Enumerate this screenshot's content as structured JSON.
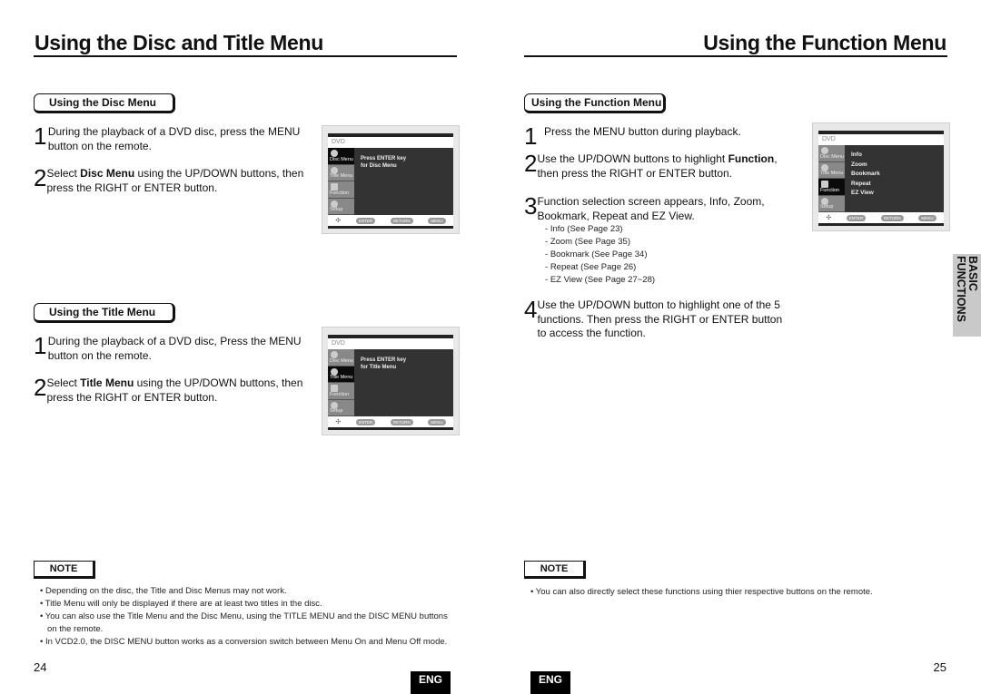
{
  "left_page": {
    "title": "Using the Disc and Title Menu",
    "disc_menu": {
      "heading": "Using the Disc Menu",
      "steps": [
        {
          "num": "1",
          "text": "During the playback of a DVD disc, press the MENU button on the remote."
        },
        {
          "num": "2",
          "pre": "Select ",
          "bold": "Disc Menu",
          "post": " using the UP/DOWN buttons, then press the RIGHT or ENTER button."
        }
      ],
      "screen": {
        "header": "DVD",
        "menu_items": [
          "Disc Menu",
          "Title Menu",
          "Function",
          "Setup"
        ],
        "selected": "Disc Menu",
        "message_line1": "Press ENTER key",
        "message_line2": "for Disc Menu",
        "footer_buttons": [
          "ENTER",
          "RETURN",
          "MENU"
        ],
        "nav_icon": "dpad-icon"
      }
    },
    "title_menu": {
      "heading": "Using the Title Menu",
      "steps": [
        {
          "num": "1",
          "text": "During the playback of a DVD disc, Press the MENU button on the remote."
        },
        {
          "num": "2",
          "pre": "Select ",
          "bold": "Title Menu",
          "post": " using the UP/DOWN buttons, then press the RIGHT or ENTER button."
        }
      ],
      "screen": {
        "header": "DVD",
        "menu_items": [
          "Disc Menu",
          "Title Menu",
          "Function",
          "Setup"
        ],
        "selected": "Title Menu",
        "message_line1": "Press ENTER key",
        "message_line2": "for Title Menu",
        "footer_buttons": [
          "ENTER",
          "RETURN",
          "MENU"
        ],
        "nav_icon": "dpad-icon"
      }
    },
    "note": {
      "label": "NOTE",
      "items": [
        "Depending on the disc, the Title and Disc Menus may not work.",
        "Title Menu will only be displayed if there are at least two titles in the disc.",
        "You can also use the Title Menu and the Disc Menu, using the TITLE MENU and the DISC MENU buttons on the remote.",
        "In VCD2.0, the DISC MENU button works as a conversion switch between Menu On and Menu Off mode."
      ]
    },
    "page_number": "24",
    "lang_badge": "ENG"
  },
  "right_page": {
    "title": "Using the Function Menu",
    "function_menu": {
      "heading": "Using the Function Menu",
      "steps": [
        {
          "num": "1",
          "text": "Press the MENU button during playback."
        },
        {
          "num": "2",
          "pre": "Use the UP/DOWN buttons to highlight ",
          "bold": "Function",
          "post": ", then press the RIGHT or ENTER button."
        },
        {
          "num": "3",
          "text": "Function selection screen appears, Info, Zoom, Bookmark, Repeat and EZ View."
        },
        {
          "num": "4",
          "text": "Use the UP/DOWN button to highlight one of the 5 functions. Then press the RIGHT or ENTER button to access the function."
        }
      ],
      "sublist": [
        "Info (See Page 23)",
        "Zoom (See Page 35)",
        "Bookmark (See Page 34)",
        "Repeat (See Page 26)",
        "EZ View (See Page 27~28)"
      ],
      "screen": {
        "header": "DVD",
        "menu_items": [
          "Disc Menu",
          "Title Menu",
          "Function",
          "Setup"
        ],
        "selected": "Function",
        "options": [
          "Info",
          "Zoom",
          "Bookmark",
          "Repeat",
          "EZ View"
        ],
        "footer_buttons": [
          "ENTER",
          "RETURN",
          "MENU"
        ],
        "nav_icon": "dpad-icon"
      }
    },
    "side_tab": "BASIC FUNCTIONS",
    "note": {
      "label": "NOTE",
      "items": [
        "You can also directly select these functions using thier respective buttons on the remote."
      ]
    },
    "page_number": "25",
    "lang_badge": "ENG"
  }
}
